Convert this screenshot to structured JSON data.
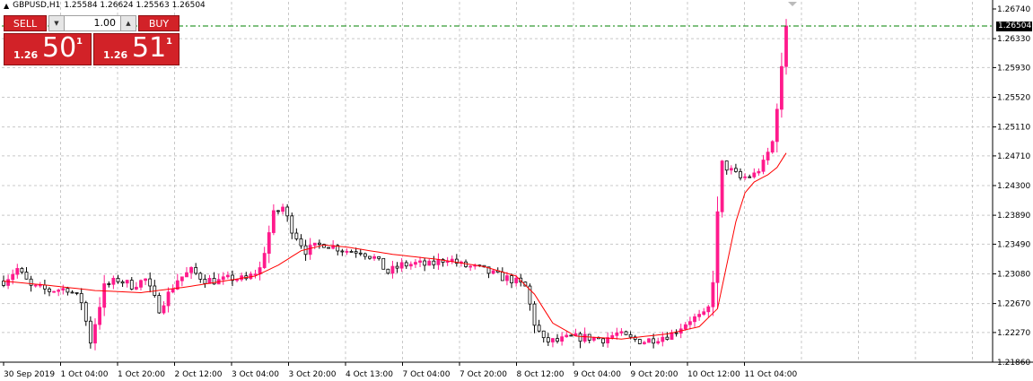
{
  "header": {
    "arrow": "▲",
    "symbol": "GBPUSD,H1",
    "ohlc": "1.25584 1.26624 1.25563 1.26504"
  },
  "trade_panel": {
    "sell_label": "SELL",
    "buy_label": "BUY",
    "lot_value": "1.00",
    "sell_prefix": "1.26",
    "sell_big": "50",
    "sell_sup": "1",
    "buy_prefix": "1.26",
    "buy_big": "51",
    "buy_sup": "1"
  },
  "current_price_label": "1.26504",
  "colors": {
    "bull": "#ff1a8c",
    "bear": "#000000",
    "ma": "#ff0000",
    "grid": "#c8c8c8",
    "bid_line": "#008000",
    "panel": "#d22228"
  },
  "chart_data": {
    "type": "candlestick",
    "symbol": "GBPUSD",
    "timeframe": "H1",
    "ylim": [
      1.2186,
      1.2674
    ],
    "y_ticks": [
      "1.26740",
      "1.26330",
      "1.25930",
      "1.25520",
      "1.25110",
      "1.24710",
      "1.24300",
      "1.23890",
      "1.23490",
      "1.23080",
      "1.22670",
      "1.22270",
      "1.21860"
    ],
    "x_ticks": [
      "30 Sep 2019",
      "1 Oct 04:00",
      "1 Oct 20:00",
      "2 Oct 12:00",
      "3 Oct 04:00",
      "3 Oct 20:00",
      "4 Oct 13:00",
      "7 Oct 04:00",
      "7 Oct 20:00",
      "8 Oct 12:00",
      "9 Oct 04:00",
      "9 Oct 20:00",
      "10 Oct 12:00",
      "11 Oct 04:00"
    ],
    "last_close": 1.26504,
    "close_path": [
      [
        0,
        1.2298
      ],
      [
        3,
        1.2315
      ],
      [
        6,
        1.229
      ],
      [
        10,
        1.2285
      ],
      [
        14,
        1.2288
      ],
      [
        17,
        1.227
      ],
      [
        19,
        1.2215
      ],
      [
        22,
        1.229
      ],
      [
        25,
        1.23
      ],
      [
        28,
        1.2292
      ],
      [
        31,
        1.23
      ],
      [
        34,
        1.226
      ],
      [
        38,
        1.23
      ],
      [
        41,
        1.2312
      ],
      [
        44,
        1.23
      ],
      [
        47,
        1.2298
      ],
      [
        50,
        1.2302
      ],
      [
        53,
        1.23
      ],
      [
        56,
        1.2315
      ],
      [
        59,
        1.239
      ],
      [
        61,
        1.24
      ],
      [
        63,
        1.237
      ],
      [
        66,
        1.234
      ],
      [
        70,
        1.235
      ],
      [
        75,
        1.234
      ],
      [
        78,
        1.234
      ],
      [
        81,
        1.233
      ],
      [
        84,
        1.231
      ],
      [
        87,
        1.232
      ],
      [
        90,
        1.2322
      ],
      [
        93,
        1.232
      ],
      [
        97,
        1.233
      ],
      [
        100,
        1.232
      ],
      [
        104,
        1.2315
      ],
      [
        108,
        1.2305
      ],
      [
        111,
        1.23
      ],
      [
        114,
        1.229
      ],
      [
        116,
        1.224
      ],
      [
        118,
        1.2215
      ],
      [
        121,
        1.2215
      ],
      [
        124,
        1.222
      ],
      [
        128,
        1.222
      ],
      [
        131,
        1.2218
      ],
      [
        134,
        1.2225
      ],
      [
        137,
        1.2218
      ],
      [
        140,
        1.2215
      ],
      [
        143,
        1.222
      ],
      [
        146,
        1.2225
      ],
      [
        150,
        1.2245
      ],
      [
        153,
        1.225
      ],
      [
        154,
        1.226
      ],
      [
        155,
        1.23
      ],
      [
        156,
        1.239
      ],
      [
        157,
        1.246
      ],
      [
        159,
        1.245
      ],
      [
        161,
        1.244
      ],
      [
        164,
        1.2445
      ],
      [
        166,
        1.246
      ],
      [
        168,
        1.249
      ],
      [
        169,
        1.254
      ],
      [
        170,
        1.259
      ],
      [
        171,
        1.265
      ]
    ],
    "ma_path": [
      [
        0,
        1.2298
      ],
      [
        10,
        1.2292
      ],
      [
        20,
        1.2285
      ],
      [
        30,
        1.2282
      ],
      [
        40,
        1.229
      ],
      [
        50,
        1.23
      ],
      [
        55,
        1.2305
      ],
      [
        60,
        1.232
      ],
      [
        65,
        1.234
      ],
      [
        70,
        1.2348
      ],
      [
        75,
        1.2345
      ],
      [
        85,
        1.2335
      ],
      [
        95,
        1.2328
      ],
      [
        105,
        1.2318
      ],
      [
        112,
        1.2305
      ],
      [
        116,
        1.228
      ],
      [
        120,
        1.224
      ],
      [
        125,
        1.2222
      ],
      [
        135,
        1.2218
      ],
      [
        145,
        1.2225
      ],
      [
        152,
        1.2235
      ],
      [
        156,
        1.226
      ],
      [
        158,
        1.232
      ],
      [
        160,
        1.238
      ],
      [
        162,
        1.242
      ],
      [
        164,
        1.2435
      ],
      [
        167,
        1.2445
      ],
      [
        169,
        1.2455
      ],
      [
        171,
        1.2475
      ]
    ]
  }
}
